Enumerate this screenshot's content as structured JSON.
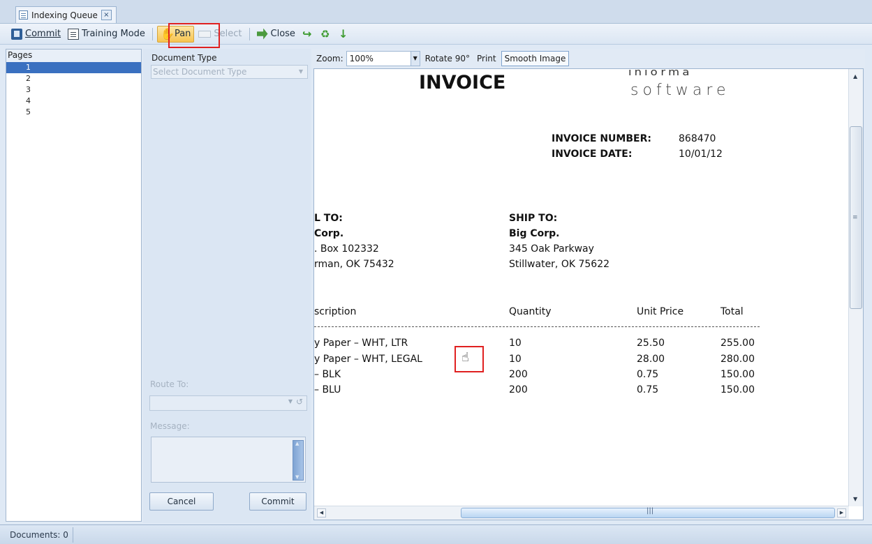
{
  "tab": {
    "title": "Indexing Queue",
    "close": "×"
  },
  "toolbar": {
    "commit": "Commit",
    "training_mode": "Training Mode",
    "pan": "Pan",
    "select": "Select",
    "close": "Close"
  },
  "pages_panel": {
    "header": "Pages",
    "items": [
      "1",
      "2",
      "3",
      "4",
      "5"
    ],
    "selected": "1"
  },
  "type_panel": {
    "document_type_label": "Document Type",
    "document_type_placeholder": "Select Document Type",
    "route_to_label": "Route To:",
    "message_label": "Message:",
    "cancel": "Cancel",
    "commit": "Commit"
  },
  "viewer_toolbar": {
    "zoom_label": "Zoom:",
    "zoom_value": "100%",
    "rotate": "Rotate 90°",
    "print": "Print",
    "smooth_image": "Smooth Image"
  },
  "invoice": {
    "title": "INVOICE",
    "logo_partial": "ᵢₙᵢₒᵣₘₐ",
    "logo_text": "software",
    "number_label": "INVOICE NUMBER:",
    "number_value": "868470",
    "date_label": "INVOICE DATE:",
    "date_value": "10/01/12",
    "bill_to": {
      "label": "L TO:",
      "name": "Corp.",
      "line1": ". Box 102332",
      "line2": "rman, OK  75432"
    },
    "ship_to": {
      "label": "SHIP TO:",
      "name": "Big Corp.",
      "line1": "345 Oak Parkway",
      "line2": "Stillwater, OK  75622"
    },
    "columns": [
      "scription",
      "Quantity",
      "Unit Price",
      "Total"
    ],
    "rows": [
      [
        "y Paper – WHT, LTR",
        "10",
        "25.50",
        "255.00"
      ],
      [
        "y Paper – WHT, LEGAL",
        "10",
        "28.00",
        "280.00"
      ],
      [
        " – BLK",
        "200",
        "0.75",
        "150.00"
      ],
      [
        " – BLU",
        "200",
        "0.75",
        "150.00"
      ]
    ]
  },
  "status": {
    "documents": "Documents: 0"
  }
}
